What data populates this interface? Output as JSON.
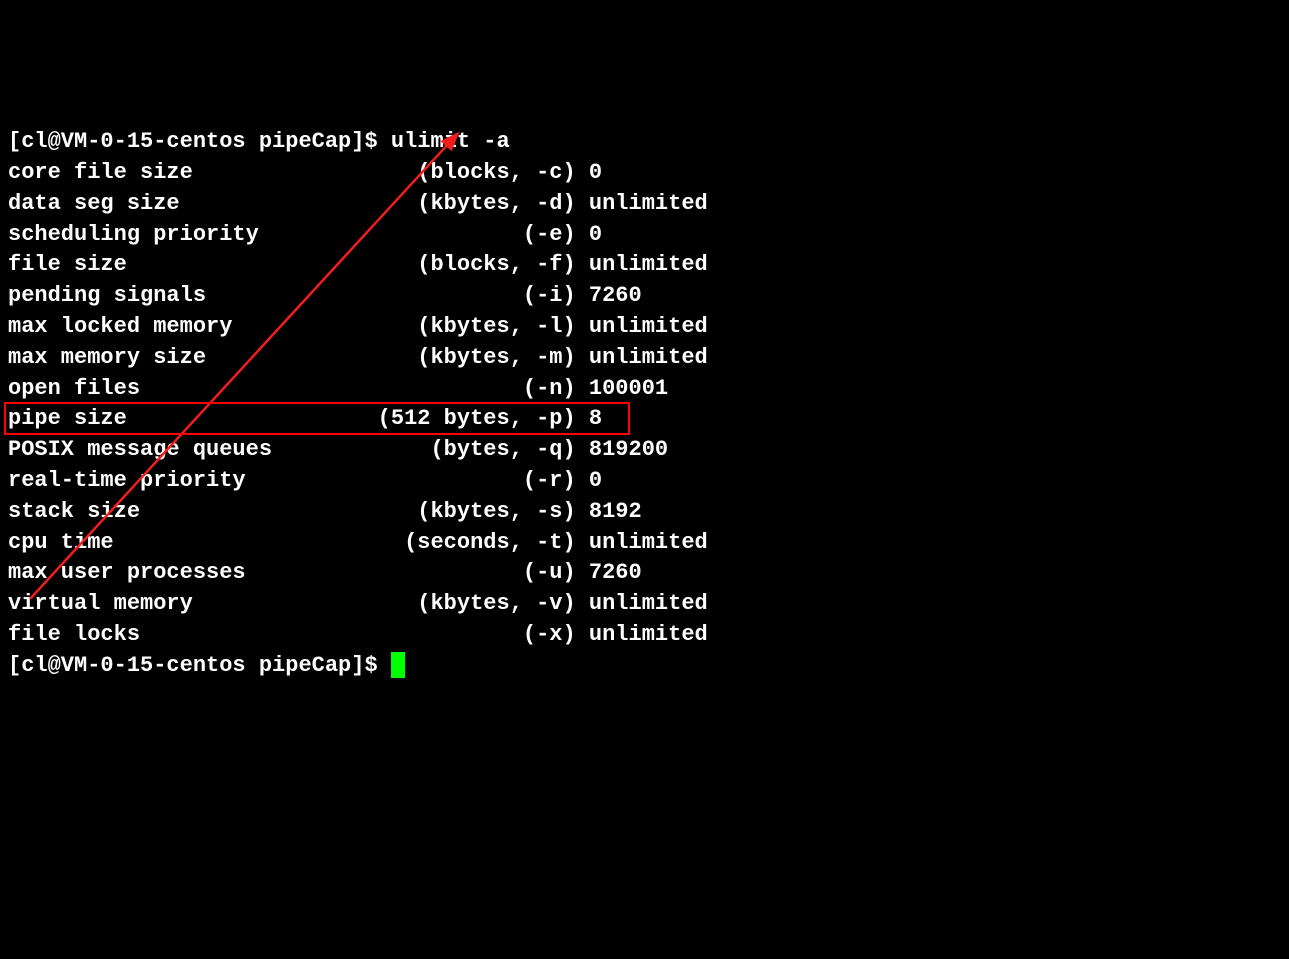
{
  "prompt1": "[cl@VM-0-15-centos pipeCap]$ ",
  "command": "ulimit -a",
  "rows": [
    {
      "name": "core file size",
      "detail": "(blocks, -c)",
      "value": "0"
    },
    {
      "name": "data seg size",
      "detail": "(kbytes, -d)",
      "value": "unlimited"
    },
    {
      "name": "scheduling priority",
      "detail": "(-e)",
      "value": "0"
    },
    {
      "name": "file size",
      "detail": "(blocks, -f)",
      "value": "unlimited"
    },
    {
      "name": "pending signals",
      "detail": "(-i)",
      "value": "7260"
    },
    {
      "name": "max locked memory",
      "detail": "(kbytes, -l)",
      "value": "unlimited"
    },
    {
      "name": "max memory size",
      "detail": "(kbytes, -m)",
      "value": "unlimited"
    },
    {
      "name": "open files",
      "detail": "(-n)",
      "value": "100001"
    },
    {
      "name": "pipe size",
      "detail": "(512 bytes, -p)",
      "value": "8"
    },
    {
      "name": "POSIX message queues",
      "detail": "(bytes, -q)",
      "value": "819200"
    },
    {
      "name": "real-time priority",
      "detail": "(-r)",
      "value": "0"
    },
    {
      "name": "stack size",
      "detail": "(kbytes, -s)",
      "value": "8192"
    },
    {
      "name": "cpu time",
      "detail": "(seconds, -t)",
      "value": "unlimited"
    },
    {
      "name": "max user processes",
      "detail": "(-u)",
      "value": "7260"
    },
    {
      "name": "virtual memory",
      "detail": "(kbytes, -v)",
      "value": "unlimited"
    },
    {
      "name": "file locks",
      "detail": "(-x)",
      "value": "unlimited"
    }
  ],
  "prompt2": "[cl@VM-0-15-centos pipeCap]$ ",
  "annotation": {
    "highlight_row_index": 8,
    "arrow_color": "#f21d1d",
    "box_color": "#f00"
  }
}
